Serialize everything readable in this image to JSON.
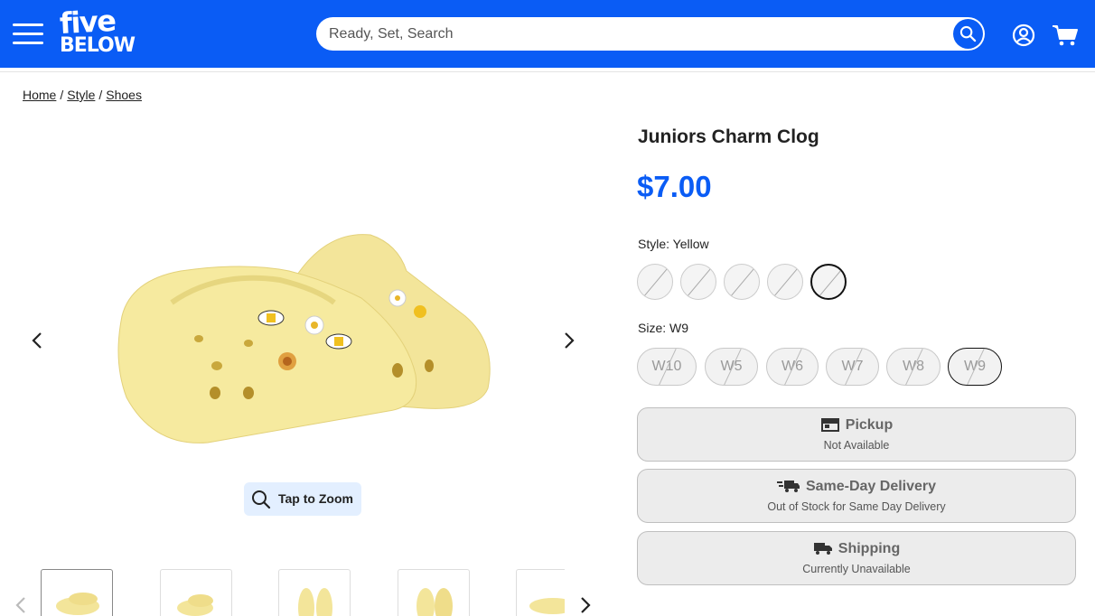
{
  "header": {
    "logo_line1": "five",
    "logo_line2": "BELOW",
    "search_placeholder": "Ready, Set, Search",
    "brand_color": "#0a5cf5"
  },
  "breadcrumb": [
    "Home",
    "Style",
    "Shoes"
  ],
  "gallery": {
    "zoom_label": "Tap to Zoom",
    "thumbnails": 5,
    "image_color": "#f3e59a"
  },
  "product": {
    "title": "Juniors Charm Clog",
    "price": "$7.00",
    "price_color": "#0a5cf5",
    "style_label": "Style:",
    "style_value": "Yellow",
    "style_swatch_count": 5,
    "size_label": "Size:",
    "size_value": "W9",
    "sizes": [
      "W10",
      "W5",
      "W6",
      "W7",
      "W8",
      "W9"
    ]
  },
  "fulfillment": [
    {
      "title": "Pickup",
      "subtitle": "Not Available",
      "icon": "store-icon"
    },
    {
      "title": "Same-Day Delivery",
      "subtitle": "Out of Stock for Same Day Delivery",
      "icon": "fast-delivery-icon"
    },
    {
      "title": "Shipping",
      "subtitle": "Currently Unavailable",
      "icon": "truck-icon"
    }
  ]
}
